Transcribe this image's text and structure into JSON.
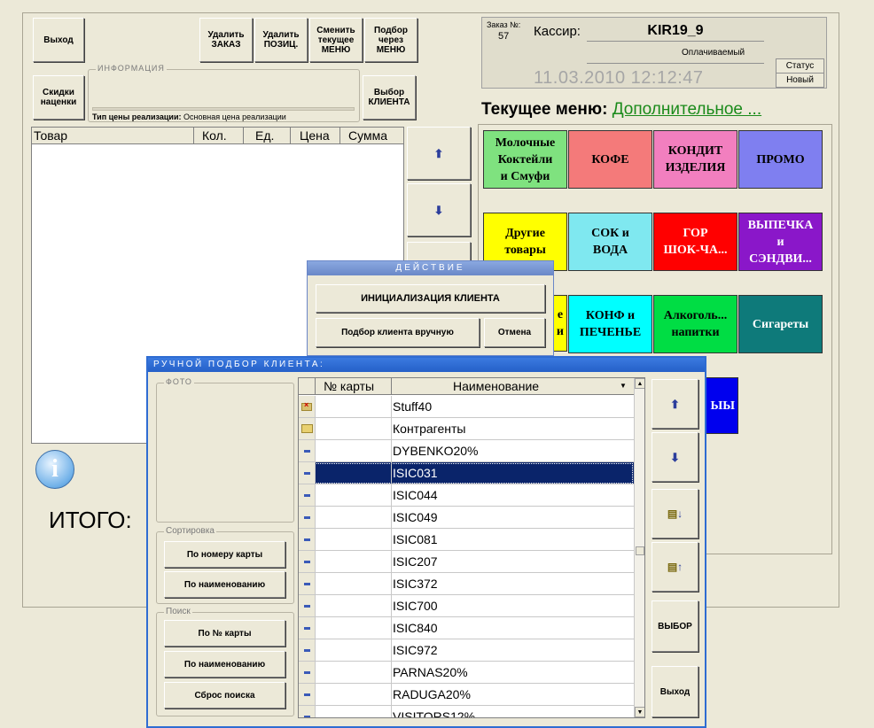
{
  "toolbar": {
    "exit": "Выход",
    "delete_order": "Удалить\nЗАКАЗ",
    "delete_position": "Удалить\nПОЗИЦ.",
    "change_menu": "Сменить\nтекущее\nМЕНЮ",
    "select_menu": "Подбор\nчерез\nМЕНЮ",
    "discounts": "Скидки\nнаценки",
    "select_client": "Выбор\nКЛИЕНТА"
  },
  "info": {
    "title": "ИНФОРМАЦИЯ",
    "price_type_label": "Тип цены реализации:",
    "price_type_value": "Основная цена реализации"
  },
  "order_table": {
    "columns": [
      "Товар",
      "Кол.",
      "Ед.",
      "Цена",
      "Сумма"
    ]
  },
  "total_label": "ИТОГО:",
  "header": {
    "order_label": "Заказ №:",
    "order_number": "57",
    "cashier_label": "Кассир:",
    "cashier_name": "KIR19_9",
    "payment_status": "Оплачиваемый",
    "datetime": "11.03.2010 12:12:47",
    "status_label": "Статус",
    "status_value": "Новый"
  },
  "current_menu": {
    "label": "Текущее меню:",
    "value": "Дополнительное ..."
  },
  "menu_tiles": [
    {
      "label": "Молочные\nКоктейли\nи Смуфи",
      "color": "#7fe27f"
    },
    {
      "label": "КОФЕ",
      "color": "#f47a7a"
    },
    {
      "label": "КОНДИТ\nИЗДЕЛИЯ",
      "color": "#f27fbf"
    },
    {
      "label": "ПРОМО",
      "color": "#7f7ff0"
    },
    {
      "label": "Другие\nтовары",
      "color": "#ffff00"
    },
    {
      "label": "СОК и\nВОДА",
      "color": "#7fe8f0"
    },
    {
      "label": "ГОР\nШОК-ЧА...",
      "color": "#ff0000"
    },
    {
      "label": "ВЫПЕЧКА\nи\nСЭНДВИ...",
      "color": "#8a17c9"
    },
    {
      "label": "е\nи",
      "color": "#ffff00"
    },
    {
      "label": "КОНФ и\nПЕЧЕНЬЕ",
      "color": "#00ffff"
    },
    {
      "label": "Алкоголь...\nнапитки",
      "color": "#00dd44"
    },
    {
      "label": "Сигареты",
      "color": "#0e7a7a"
    },
    {
      "label": "ЫЫ",
      "color": "#0000ee"
    }
  ],
  "action_dialog": {
    "title": "ДЕЙСТВИЕ",
    "init_client": "ИНИЦИАЛИЗАЦИЯ КЛИЕНТА",
    "manual_select": "Подбор клиента вручную",
    "cancel": "Отмена"
  },
  "client_dialog": {
    "title": "РУЧНОЙ ПОДБОР КЛИЕНТА:",
    "photo_label": "ФОТО",
    "sort_label": "Сортировка",
    "sort_by_card": "По номеру карты",
    "sort_by_name": "По наименованию",
    "search_label": "Поиск",
    "search_by_card": "По № карты",
    "search_by_name": "По наименованию",
    "reset_search": "Сброс поиска",
    "col_card": "№ карты",
    "col_name": "Наименование",
    "select_button": "ВЫБОР",
    "exit_button": "Выход",
    "rows": [
      {
        "name": "Stuff40",
        "icon": "deleted"
      },
      {
        "name": "Контрагенты",
        "icon": "folder"
      },
      {
        "name": "DYBENKO20%",
        "icon": "item"
      },
      {
        "name": "ISIC031",
        "icon": "item"
      },
      {
        "name": "ISIC044",
        "icon": "item"
      },
      {
        "name": "ISIC049",
        "icon": "item"
      },
      {
        "name": "ISIC081",
        "icon": "item"
      },
      {
        "name": "ISIC207",
        "icon": "item"
      },
      {
        "name": "ISIC372",
        "icon": "item"
      },
      {
        "name": "ISIC700",
        "icon": "item"
      },
      {
        "name": "ISIC840",
        "icon": "item"
      },
      {
        "name": "ISIC972",
        "icon": "item"
      },
      {
        "name": "PARNAS20%",
        "icon": "item"
      },
      {
        "name": "RADUGA20%",
        "icon": "item"
      },
      {
        "name": "VISITORS12%",
        "icon": "item"
      }
    ],
    "selected_row": 3
  }
}
